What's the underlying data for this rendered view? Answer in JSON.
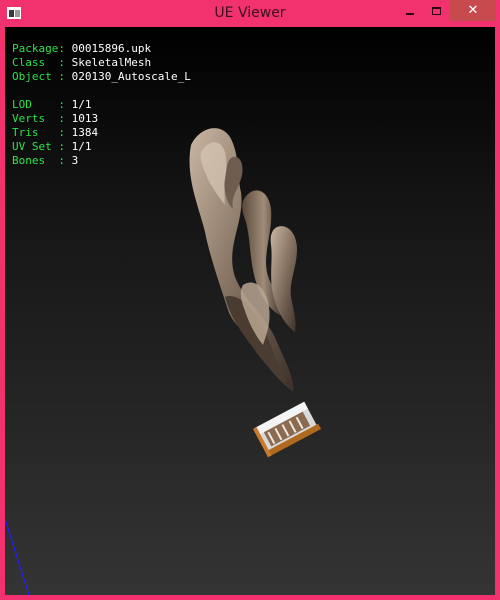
{
  "window": {
    "title": "UE Viewer",
    "controls": {
      "minimize": "minimize",
      "maximize": "maximize",
      "close": "✕"
    }
  },
  "viewport": {
    "info_top": [
      {
        "label": "Package: ",
        "value": "00015896.upk"
      },
      {
        "label": "Class  : ",
        "value": "SkeletalMesh"
      },
      {
        "label": "Object : ",
        "value": "020130_Autoscale_L"
      }
    ],
    "info_bottom": [
      {
        "label": "LOD    : ",
        "value": "1/1"
      },
      {
        "label": "Verts  : ",
        "value": "1013"
      },
      {
        "label": "Tris   : ",
        "value": "1384"
      },
      {
        "label": "UV Set : ",
        "value": "1/1"
      },
      {
        "label": "Bones  : ",
        "value": "3"
      }
    ]
  },
  "colors": {
    "frame": "#f2326e",
    "label": "#2ee24a",
    "value": "#ffffff",
    "mesh_wood": "#8a7766",
    "axis": "#2020ff"
  }
}
